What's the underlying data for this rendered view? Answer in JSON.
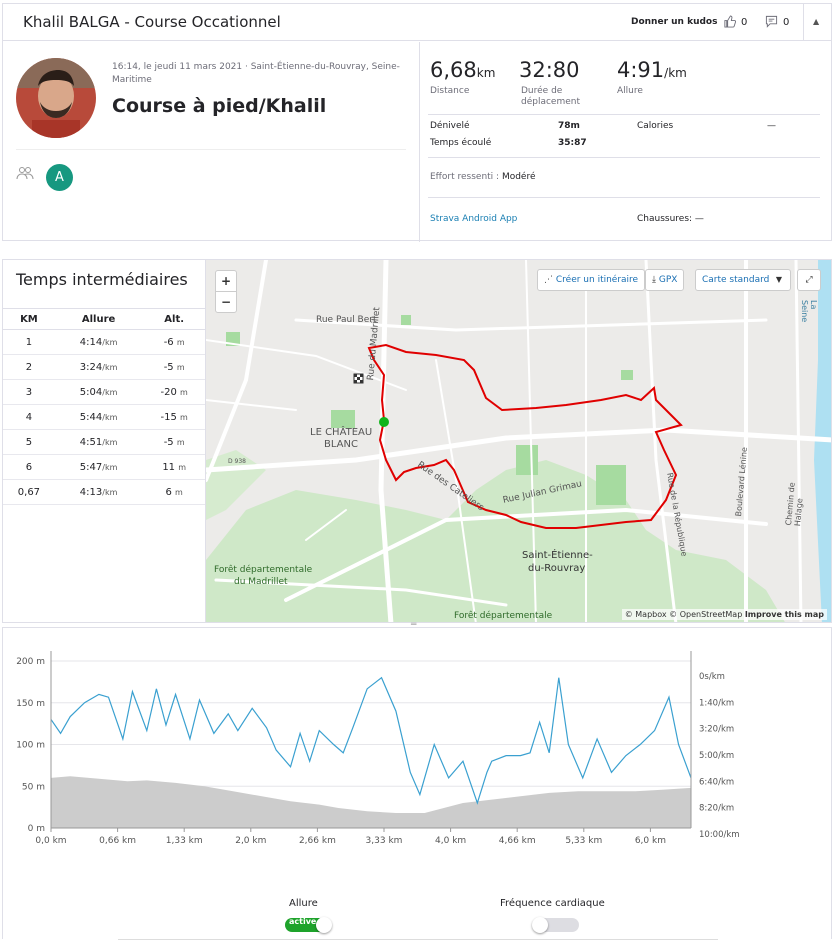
{
  "header": {
    "title": "Khalil BALGA - Course Occationnel",
    "kudos_label": "Donner un kudos",
    "kudos_count": "0",
    "comments_count": "0"
  },
  "activity": {
    "date": "16:14, le jeudi 11 mars 2021 · Saint-Étienne-du-Rouvray, Seine-Maritime",
    "name": "Course à pied/Khalil",
    "athlete_initial": "A"
  },
  "stats": {
    "distance": "6,68",
    "distance_unit": "km",
    "distance_label": "Distance",
    "moving_time": "32:80",
    "moving_time_label": "Durée de déplacement",
    "pace": "4:91",
    "pace_unit": "/km",
    "pace_label": "Allure",
    "elevation_label": "Dénivelé",
    "elevation": "78m",
    "elapsed_label": "Temps écoulé",
    "elapsed": "35:87",
    "calories_label": "Calories",
    "calories": "—",
    "effort": "Effort ressenti : ",
    "effort_value": "Modéré",
    "device": "Strava Android App",
    "shoes": "Chaussures: —"
  },
  "splits": {
    "title": "Temps intermédiaires",
    "headers": [
      "KM",
      "Allure",
      "Alt."
    ],
    "rows": [
      {
        "km": "1",
        "pace": "4:14",
        "unit": "/km",
        "alt": "-6",
        "alt_unit": "m"
      },
      {
        "km": "2",
        "pace": "3:24",
        "unit": "/km",
        "alt": "-5",
        "alt_unit": "m"
      },
      {
        "km": "3",
        "pace": "5:04",
        "unit": "/km",
        "alt": "-20",
        "alt_unit": "m"
      },
      {
        "km": "4",
        "pace": "5:44",
        "unit": "/km",
        "alt": "-15",
        "alt_unit": "m"
      },
      {
        "km": "5",
        "pace": "4:51",
        "unit": "/km",
        "alt": "-5",
        "alt_unit": "m"
      },
      {
        "km": "6",
        "pace": "5:47",
        "unit": "/km",
        "alt": "11",
        "alt_unit": "m"
      },
      {
        "km": "0,67",
        "pace": "4:13",
        "unit": "/km",
        "alt": "6",
        "alt_unit": "m"
      }
    ]
  },
  "map": {
    "zoom_in": "+",
    "zoom_out": "−",
    "create_route": "Créer un itinéraire",
    "gpx": "GPX",
    "map_style": "Carte standard",
    "labels": {
      "rue_paul_bert": "Rue Paul Bert",
      "rue_madrillet": "Rue du Madrillet",
      "chateau_1": "LE CHÂTEAU",
      "chateau_2": "BLANC",
      "rue_cateliers": "Rue des Cateliers",
      "rue_grimau": "Rue Julian Grimau",
      "st_etienne_1": "Saint-Étienne-",
      "st_etienne_2": "du-Rouvray",
      "foret_1": "Forêt départementale",
      "foret_2": "du Madrillet",
      "foret_3": "Forêt départementale",
      "bd_lenine": "Boulevard Lénine",
      "rue_republique": "Rue de la République",
      "chemin_halage": "Chemin de Halage",
      "seine": "La Seine",
      "d938": "D 938"
    },
    "attribution_1": "© Mapbox © OpenStreetMap ",
    "attribution_2": "Improve this map",
    "colors": {
      "route": "#e00000",
      "start": "#11b51b"
    }
  },
  "chart_data": {
    "type": "area",
    "x_ticks": [
      "0,0 km",
      "0,66 km",
      "1,33 km",
      "2,0 km",
      "2,66 km",
      "3,33 km",
      "4,0 km",
      "4,66 km",
      "5,33 km",
      "6,0 km"
    ],
    "y_left_ticks": [
      "200 m",
      "150 m",
      "100 m",
      "50 m",
      "0 m"
    ],
    "y_right_ticks": [
      "0s/km",
      "1:40/km",
      "3:20/km",
      "5:00/km",
      "6:40/km",
      "8:20/km",
      "10:00/km"
    ],
    "xlim": [
      0,
      6.68
    ],
    "ylim_left": [
      0,
      200
    ],
    "ylim_right_seconds": [
      0,
      600
    ],
    "series": [
      {
        "name": "Alt.",
        "color": "#cccccc",
        "x": [
          0,
          0.2,
          0.5,
          0.8,
          1.0,
          1.3,
          1.6,
          1.9,
          2.2,
          2.5,
          2.8,
          3.0,
          3.3,
          3.6,
          3.9,
          4.1,
          4.3,
          4.6,
          4.9,
          5.2,
          5.5,
          5.8,
          6.1,
          6.4,
          6.68
        ],
        "y": [
          60,
          62,
          59,
          56,
          57,
          54,
          50,
          44,
          38,
          32,
          28,
          24,
          20,
          18,
          18,
          24,
          30,
          34,
          38,
          42,
          44,
          44,
          44,
          46,
          48
        ]
      },
      {
        "name": "Allure",
        "color": "#3aa0d0",
        "x": [
          0,
          0.1,
          0.2,
          0.35,
          0.5,
          0.6,
          0.75,
          0.85,
          1.0,
          1.1,
          1.2,
          1.3,
          1.45,
          1.55,
          1.7,
          1.85,
          1.95,
          2.1,
          2.25,
          2.35,
          2.5,
          2.6,
          2.7,
          2.8,
          2.95,
          3.05,
          3.15,
          3.3,
          3.45,
          3.6,
          3.75,
          3.85,
          4.0,
          4.15,
          4.3,
          4.45,
          4.55,
          4.6,
          4.75,
          4.9,
          5.0,
          5.1,
          5.2,
          5.3,
          5.4,
          5.55,
          5.7,
          5.85,
          6.0,
          6.15,
          6.3,
          6.45,
          6.55,
          6.68
        ],
        "y_seconds": [
          210,
          260,
          200,
          150,
          120,
          130,
          280,
          110,
          250,
          100,
          230,
          120,
          280,
          140,
          260,
          190,
          250,
          170,
          240,
          320,
          380,
          260,
          360,
          250,
          300,
          330,
          240,
          100,
          60,
          180,
          400,
          480,
          300,
          420,
          360,
          510,
          400,
          360,
          340,
          340,
          330,
          220,
          330,
          60,
          300,
          420,
          280,
          400,
          340,
          300,
          250,
          130,
          300,
          420
        ]
      }
    ]
  },
  "toggles": {
    "pace_label": "Allure",
    "pace_state": "active",
    "hr_label": "Fréquence cardiaque"
  }
}
